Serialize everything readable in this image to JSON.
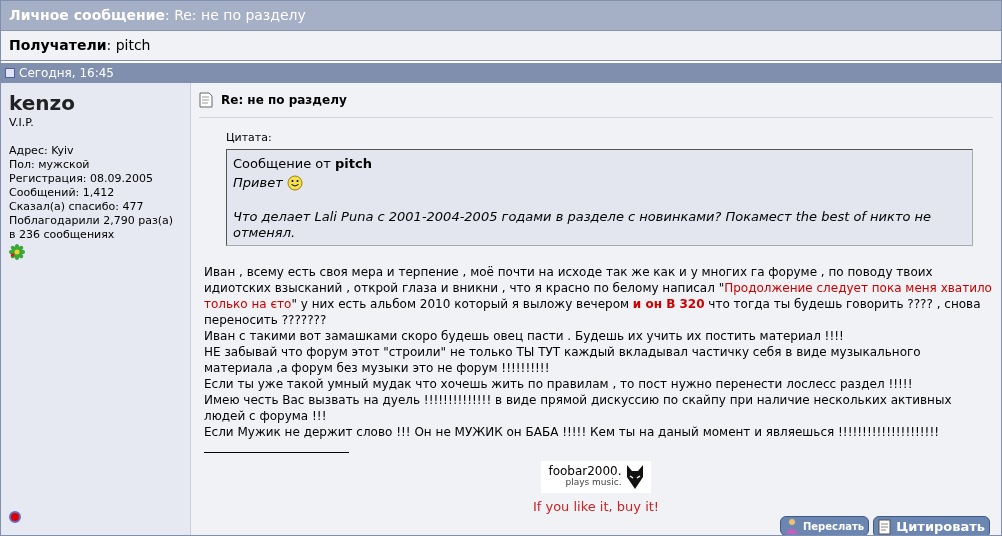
{
  "title": {
    "label": "Личное сообщение",
    "separator": ":",
    "value": "Re: не по разделу"
  },
  "recipients": {
    "label": "Получатели",
    "separator": ":",
    "value": "pitch"
  },
  "post_header": {
    "date": "Сегодня, 16:45"
  },
  "author": {
    "name": "kenzo",
    "rank": "V.I.P.",
    "online": false,
    "details": [
      "Адрес: Kyiv",
      "Пол: мужской",
      "Регистрация: 08.09.2005",
      "Сообщений: 1,412",
      "Сказал(а) спасибо: 477",
      "Поблагодарили 2,790 раз(а)",
      "в 236 сообщениях"
    ]
  },
  "post": {
    "title": "Re: не по разделу",
    "quote": {
      "label": "Цитата:",
      "from_prefix": "Сообщение от",
      "from": "pitch",
      "lines": [
        "Привет",
        "Что делает Lali Puna с 2001-2004-2005 годами в разделе с новинками? Покамест the best of никто не отменял."
      ]
    },
    "paragraphs": [
      [
        {
          "kind": "plain",
          "text": "Иван , всему есть своя мера и терпение , моё почти на исходе так же как и у многих га форуме , по поводу твоих идиотских взысканий , открой глаза и вникни , что я красно по белому написал \""
        },
        {
          "kind": "red",
          "text": "Продолжение следует пока меня хватило только на єто"
        },
        {
          "kind": "plain",
          "text": "\" у них есть альбом 2010 который я выложу вечером "
        },
        {
          "kind": "red_bold",
          "text": "и он В 320"
        },
        {
          "kind": "plain",
          "text": " что тогда ты будешь говорить ???? , снова переносить ???????"
        }
      ],
      [
        {
          "kind": "plain",
          "text": "Иван с такими вот замашками скоро будешь овец пасти . Будешь их учить их постить материал !!!!"
        }
      ],
      [
        {
          "kind": "plain",
          "text": "НЕ забывай что форум этот \"строили\" не только ТЫ ТУТ каждый вкладывал частичку себя в виде музыкального материала ,а форум без музыки это не форум !!!!!!!!!!"
        }
      ],
      [
        {
          "kind": "plain",
          "text": "Если ты уже такой умный мудак что хочешь жить по правилам , то пост нужно перенести лослесс раздел !!!!!"
        }
      ],
      [
        {
          "kind": "plain",
          "text": "Имею честь Вас вызвать на дуель !!!!!!!!!!!!!! в виде прямой дискуссию по скайпу при наличие нескольких активных людей с форума !!!"
        }
      ],
      [
        {
          "kind": "plain",
          "text": "Если Мужик не держит слово !!! Он не МУЖИК он БАБА !!!!! Кем ты на даный момент и являешься !!!!!!!!!!!!!!!!!!!!!"
        }
      ]
    ],
    "signature": {
      "logo_name": "foobar2000.",
      "logo_tagline": "plays music.",
      "slogan": "If you like it, buy it!"
    },
    "buttons": [
      "Переслать",
      "Цитировать"
    ]
  }
}
